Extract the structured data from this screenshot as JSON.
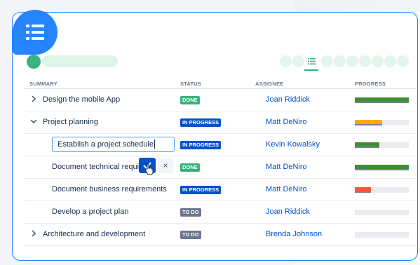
{
  "header": {
    "summary": "SUMMARY",
    "status": "STATUS",
    "assignee": "ASSIGNEE",
    "progress": "PROGRESS"
  },
  "icons": {
    "badge": "list-icon",
    "view_tabs": [
      "dot",
      "dot",
      "list-icon",
      "dot",
      "dot",
      "dot",
      "dot",
      "dot",
      "dot",
      "dot"
    ]
  },
  "colors": {
    "accent": "#2684ff",
    "done": "#36b37e",
    "in_progress": "#0052cc",
    "to_do": "#6b778c",
    "progress_green": "#3e8f2e",
    "progress_yellow": "#ffab00",
    "progress_red": "#ff5630"
  },
  "rows": [
    {
      "summary": "Design the mobile App",
      "status": "DONE",
      "assignee": "Joan Riddick",
      "progress": 1.0,
      "color": "#3e8f2e",
      "expander": "chevron-right"
    },
    {
      "summary": "Project planning",
      "status": "IN PROGRESS",
      "assignee": "Matt DeNiro",
      "progress": 0.5,
      "color": "#ffab00",
      "expander": "chevron-down"
    },
    {
      "summary": "Establish a project schedule",
      "status": "IN PROGRESS",
      "assignee": "Kevin Kowalsky",
      "progress": 0.45,
      "color": "#3e8f2e",
      "editing": true
    },
    {
      "summary": "Document technical requi",
      "status": "DONE",
      "assignee": "Matt DeNiro",
      "progress": 1.0,
      "color": "#3e8f2e"
    },
    {
      "summary": "Document business requirements",
      "status": "IN PROGRESS",
      "assignee": "Matt DeNiro",
      "progress": 0.3,
      "color": "#ff5630"
    },
    {
      "summary": "Develop a project plan",
      "status": "TO DO",
      "assignee": "Joan Riddick",
      "progress": 0,
      "color": "#3e8f2e"
    },
    {
      "summary": "Architecture and development",
      "status": "TO DO",
      "assignee": "Brenda Johnson",
      "progress": 0,
      "color": "#3e8f2e",
      "expander": "chevron-right"
    }
  ],
  "edit_actions": {
    "cancel_symbol": "×"
  }
}
